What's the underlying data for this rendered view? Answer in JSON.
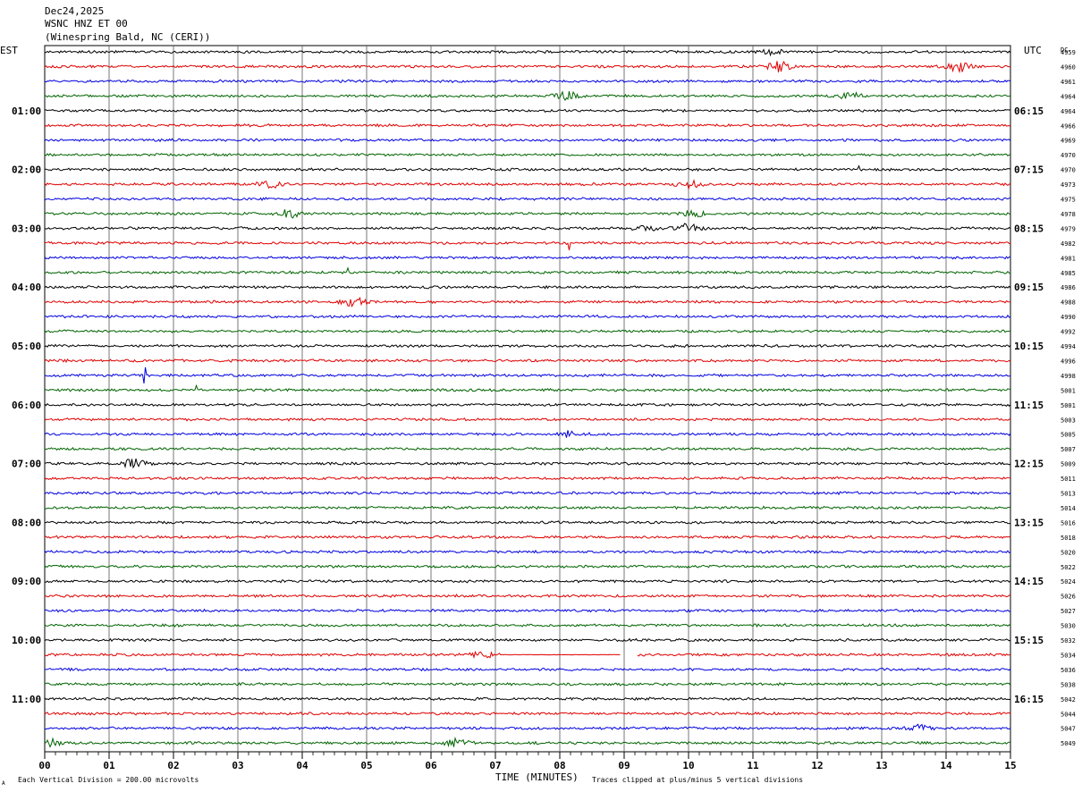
{
  "header": {
    "date": "Dec24,2025",
    "station": "WSNC HNZ ET 00",
    "location": "(Winespring Bald, NC (CERI))"
  },
  "left_label": "EST",
  "right_label": "UTC",
  "dc_label": "DC",
  "footer": {
    "left_mark": "A",
    "scale_text": "Each Vertical Division =  200.00 microvolts",
    "xlabel": "TIME (MINUTES)",
    "clip_text": "Traces clipped at plus/minus 5 vertical divisions"
  },
  "chart_data": {
    "type": "line",
    "xlabel": "TIME (MINUTES)",
    "xlim": [
      0,
      15
    ],
    "x_ticks": [
      "00",
      "01",
      "02",
      "03",
      "04",
      "05",
      "06",
      "07",
      "08",
      "09",
      "10",
      "11",
      "12",
      "13",
      "14",
      "15"
    ],
    "x_minor_per_minute": 6,
    "trace_colors": [
      "#000000",
      "#e00000",
      "#0000e0",
      "#006400"
    ],
    "est_hour_labels": [
      "01:00",
      "02:00",
      "03:00",
      "04:00",
      "05:00",
      "06:00",
      "07:00",
      "08:00",
      "09:00",
      "10:00",
      "11:00"
    ],
    "utc_hour_labels": [
      "06:15",
      "07:15",
      "08:15",
      "09:15",
      "10:15",
      "11:15",
      "12:15",
      "13:15",
      "14:15",
      "15:15",
      "16:15"
    ],
    "dc_offsets": [
      "4959",
      "4960",
      "4961",
      "4964",
      "4964",
      "4966",
      "4969",
      "4970",
      "4970",
      "4973",
      "4975",
      "4978",
      "4979",
      "4982",
      "4981",
      "4985",
      "4986",
      "4988",
      "4990",
      "4992",
      "4994",
      "4996",
      "4998",
      "5001",
      "5001",
      "5003",
      "5005",
      "5007",
      "5009",
      "5011",
      "5013",
      "5014",
      "5016",
      "5018",
      "5020",
      "5022",
      "5024",
      "5026",
      "5027",
      "5030",
      "5032",
      "5034",
      "5036",
      "5038",
      "5042",
      "5044",
      "5047",
      "5049"
    ],
    "events": [
      {
        "trace": 0,
        "t": 11.3,
        "amp": 1.0
      },
      {
        "trace": 1,
        "t": 11.4,
        "amp": 2.0
      },
      {
        "trace": 1,
        "t": 14.2,
        "amp": 1.8
      },
      {
        "trace": 3,
        "t": 8.1,
        "amp": 1.6
      },
      {
        "trace": 3,
        "t": 12.5,
        "amp": 1.4
      },
      {
        "trace": 9,
        "t": 3.5,
        "amp": 1.2
      },
      {
        "trace": 9,
        "t": 10.0,
        "amp": 1.4
      },
      {
        "trace": 11,
        "t": 3.8,
        "amp": 1.6
      },
      {
        "trace": 11,
        "t": 10.1,
        "amp": 1.3
      },
      {
        "trace": 12,
        "t": 9.3,
        "amp": 1.2
      },
      {
        "trace": 12,
        "t": 10.0,
        "amp": 1.6
      },
      {
        "trace": 17,
        "t": 4.8,
        "amp": 1.5
      },
      {
        "trace": 26,
        "t": 8.2,
        "amp": 1.3
      },
      {
        "trace": 28,
        "t": 1.4,
        "amp": 2.0
      },
      {
        "trace": 41,
        "t": 6.8,
        "amp": 1.2
      },
      {
        "trace": 46,
        "t": 13.6,
        "amp": 1.2
      },
      {
        "trace": 47,
        "t": 0.1,
        "amp": 1.3
      },
      {
        "trace": 47,
        "t": 6.4,
        "amp": 1.4
      }
    ],
    "spikes": [
      {
        "trace": 13,
        "t": 8.15,
        "amp": 8
      },
      {
        "trace": 22,
        "t": 1.55,
        "amp": 9
      },
      {
        "trace": 23,
        "t": 2.35,
        "amp": 5
      },
      {
        "trace": 15,
        "t": 4.7,
        "amp": 5
      },
      {
        "trace": 8,
        "t": 12.65,
        "amp": 4
      }
    ],
    "gaps": [
      {
        "trace": 41,
        "t0": 8.95,
        "t1": 9.2
      }
    ],
    "flat_segments": [
      {
        "trace": 41,
        "t0": 7.1,
        "t1": 8.95
      }
    ]
  }
}
